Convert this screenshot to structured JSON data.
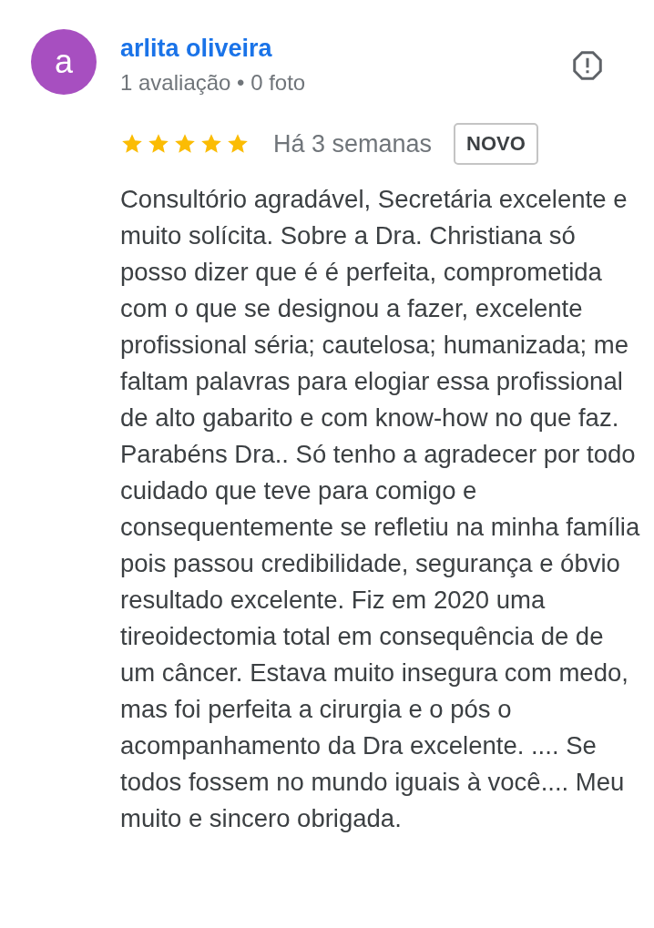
{
  "review": {
    "avatar_letter": "a",
    "author": "arlita oliveira",
    "meta": "1 avaliação • 0 foto",
    "stars": 5,
    "time": "Há 3 semanas",
    "badge": "NOVO",
    "text": "Consultório agradável, Secretária excelente e muito solícita. Sobre a Dra. Christiana só posso dizer que é é perfeita, comprometida com o que se designou a fazer, excelente profissional séria; cautelosa; humanizada; me faltam palavras para elogiar essa profissional de alto gabarito e com know-how no que faz. Parabéns Dra.. Só tenho a agradecer por todo cuidado que teve para comigo e consequentemente se refletiu na minha família pois passou credibilidade, segurança e óbvio resultado excelente. Fiz em 2020 uma tireoidectomia total em consequência de de um câncer. Estava muito insegura com medo, mas foi perfeita a cirurgia e o pós o acompanhamento da Dra excelente. .... Se todos fossem no mundo iguais à você.... Meu muito e sincero obrigada."
  }
}
